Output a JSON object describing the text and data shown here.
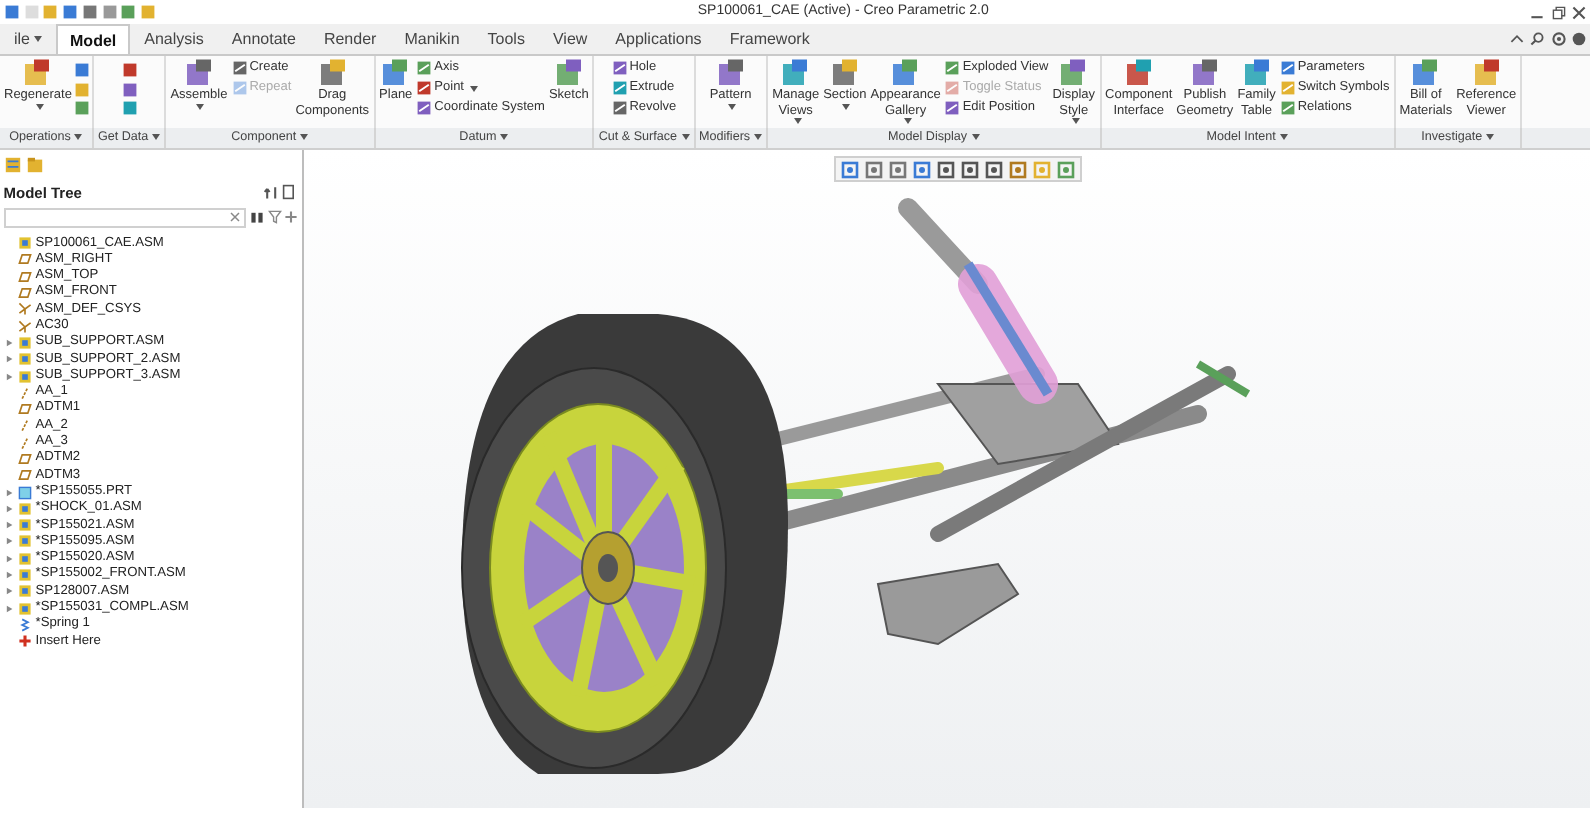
{
  "title_bar": {
    "title": "SP100061_CAE (Active) - Creo Parametric 2.0"
  },
  "tabs": [
    {
      "label": "ile",
      "selected": false,
      "has_menu": true
    },
    {
      "label": "Model",
      "selected": true,
      "has_menu": false
    },
    {
      "label": "Analysis",
      "selected": false,
      "has_menu": false
    },
    {
      "label": "Annotate",
      "selected": false,
      "has_menu": false
    },
    {
      "label": "Render",
      "selected": false,
      "has_menu": false
    },
    {
      "label": "Manikin",
      "selected": false,
      "has_menu": false
    },
    {
      "label": "Tools",
      "selected": false,
      "has_menu": false
    },
    {
      "label": "View",
      "selected": false,
      "has_menu": false
    },
    {
      "label": "Applications",
      "selected": false,
      "has_menu": false
    },
    {
      "label": "Framework",
      "selected": false,
      "has_menu": false
    }
  ],
  "ribbon": {
    "groups": [
      {
        "label": "Operations",
        "columns": [
          {
            "kind": "large",
            "label": "Regenerate",
            "has_menu": true,
            "disabled": false
          },
          {
            "kind": "icon-stack"
          }
        ]
      },
      {
        "label": "Get Data",
        "columns": [
          {
            "kind": "icon-stack"
          }
        ]
      },
      {
        "label": "Component",
        "columns": [
          {
            "kind": "large",
            "label": "Assemble",
            "has_menu": true,
            "disabled": false
          },
          {
            "kind": "stack",
            "items": [
              {
                "label": "Create",
                "has_menu": false,
                "disabled": false
              },
              {
                "label": "Repeat",
                "has_menu": false,
                "disabled": true
              }
            ]
          },
          {
            "kind": "large",
            "label": "Drag Components",
            "has_menu": false,
            "disabled": false
          }
        ]
      },
      {
        "label": "Datum",
        "columns": [
          {
            "kind": "large",
            "label": "Plane",
            "has_menu": false,
            "disabled": false
          },
          {
            "kind": "stack",
            "items": [
              {
                "label": "Axis",
                "has_menu": false,
                "disabled": false
              },
              {
                "label": "Point",
                "has_menu": true,
                "disabled": false
              },
              {
                "label": "Coordinate System",
                "has_menu": false,
                "disabled": false
              }
            ]
          },
          {
            "kind": "large",
            "label": "Sketch",
            "has_menu": false,
            "disabled": false
          }
        ]
      },
      {
        "label": "Cut & Surface",
        "columns": [
          {
            "kind": "stack",
            "items": [
              {
                "label": "Hole",
                "has_menu": false,
                "disabled": false
              },
              {
                "label": "Extrude",
                "has_menu": false,
                "disabled": false
              },
              {
                "label": "Revolve",
                "has_menu": false,
                "disabled": false
              }
            ]
          }
        ]
      },
      {
        "label": "Modifiers",
        "columns": [
          {
            "kind": "large",
            "label": "Pattern",
            "has_menu": true,
            "disabled": false
          }
        ]
      },
      {
        "label": "Model Display",
        "columns": [
          {
            "kind": "large",
            "label": "Manage Views",
            "has_menu": true,
            "disabled": false
          },
          {
            "kind": "large",
            "label": "Section",
            "has_menu": true,
            "disabled": false
          },
          {
            "kind": "large",
            "label": "Appearance Gallery",
            "has_menu": true,
            "disabled": false
          },
          {
            "kind": "stack",
            "items": [
              {
                "label": "Exploded View",
                "has_menu": false,
                "disabled": false
              },
              {
                "label": "Toggle Status",
                "has_menu": false,
                "disabled": true
              },
              {
                "label": "Edit Position",
                "has_menu": false,
                "disabled": false
              }
            ]
          },
          {
            "kind": "large",
            "label": "Display Style",
            "has_menu": true,
            "disabled": false
          }
        ]
      },
      {
        "label": "Model Intent",
        "columns": [
          {
            "kind": "large",
            "label": "Component Interface",
            "has_menu": false,
            "disabled": false
          },
          {
            "kind": "large",
            "label": "Publish Geometry",
            "has_menu": false,
            "disabled": false
          },
          {
            "kind": "large",
            "label": "Family Table",
            "has_menu": false,
            "disabled": false
          },
          {
            "kind": "stack",
            "items": [
              {
                "label": "Parameters",
                "has_menu": false,
                "disabled": false
              },
              {
                "label": "Switch Symbols",
                "has_menu": false,
                "disabled": false
              },
              {
                "label": "Relations",
                "has_menu": false,
                "disabled": false
              }
            ]
          }
        ]
      },
      {
        "label": "Investigate",
        "columns": [
          {
            "kind": "large",
            "label": "Bill of Materials",
            "has_menu": false,
            "disabled": false
          },
          {
            "kind": "large",
            "label": "Reference Viewer",
            "has_menu": false,
            "disabled": false
          }
        ]
      }
    ]
  },
  "model_tree": {
    "title": "Model Tree",
    "items": [
      {
        "label": "SP100061_CAE.ASM",
        "kind": "assembly",
        "expandable": false
      },
      {
        "label": "ASM_RIGHT",
        "kind": "plane",
        "expandable": false
      },
      {
        "label": "ASM_TOP",
        "kind": "plane",
        "expandable": false
      },
      {
        "label": "ASM_FRONT",
        "kind": "plane",
        "expandable": false
      },
      {
        "label": "ASM_DEF_CSYS",
        "kind": "csys",
        "expandable": false
      },
      {
        "label": "AC30",
        "kind": "csys",
        "expandable": false
      },
      {
        "label": "SUB_SUPPORT.ASM",
        "kind": "assembly",
        "expandable": true
      },
      {
        "label": "SUB_SUPPORT_2.ASM",
        "kind": "assembly",
        "expandable": true
      },
      {
        "label": "SUB_SUPPORT_3.ASM",
        "kind": "assembly",
        "expandable": true
      },
      {
        "label": "AA_1",
        "kind": "axis",
        "expandable": false
      },
      {
        "label": "ADTM1",
        "kind": "plane",
        "expandable": false
      },
      {
        "label": "AA_2",
        "kind": "axis",
        "expandable": false
      },
      {
        "label": "AA_3",
        "kind": "axis",
        "expandable": false
      },
      {
        "label": "ADTM2",
        "kind": "plane",
        "expandable": false
      },
      {
        "label": "ADTM3",
        "kind": "plane",
        "expandable": false
      },
      {
        "label": "*SP155055.PRT",
        "kind": "part",
        "expandable": true
      },
      {
        "label": "*SHOCK_01.ASM",
        "kind": "assembly",
        "expandable": true
      },
      {
        "label": "*SP155021.ASM",
        "kind": "assembly",
        "expandable": true
      },
      {
        "label": "*SP155095.ASM",
        "kind": "assembly",
        "expandable": true
      },
      {
        "label": "*SP155020.ASM",
        "kind": "assembly",
        "expandable": true
      },
      {
        "label": "*SP155002_FRONT.ASM",
        "kind": "assembly",
        "expandable": true
      },
      {
        "label": "SP128007.ASM",
        "kind": "assembly",
        "expandable": true
      },
      {
        "label": "*SP155031_COMPL.ASM",
        "kind": "assembly",
        "expandable": true
      },
      {
        "label": "*Spring 1",
        "kind": "spring",
        "expandable": false
      },
      {
        "label": "Insert Here",
        "kind": "insert",
        "expandable": false
      }
    ]
  }
}
